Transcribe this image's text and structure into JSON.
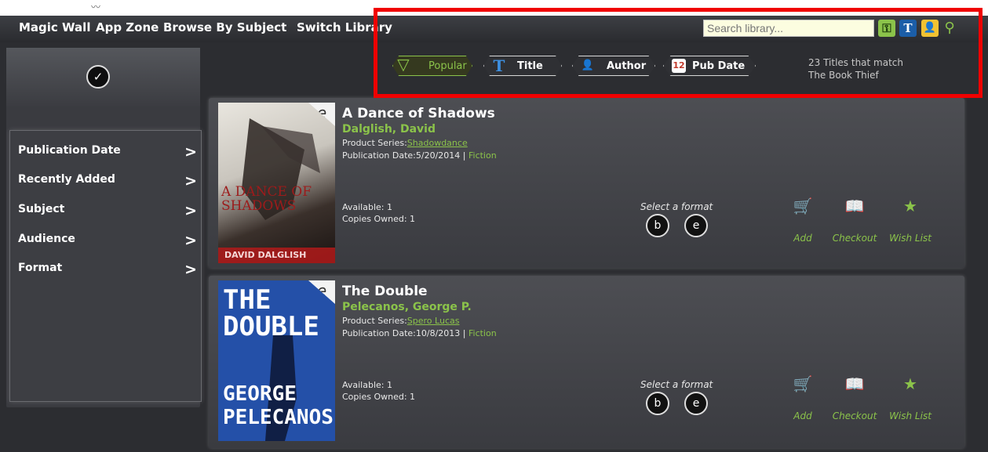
{
  "nav": {
    "items": [
      "Magic Wall",
      "App Zone",
      "Browse By Subject",
      "Switch Library"
    ]
  },
  "search": {
    "placeholder": "Search library..."
  },
  "toolbar_icons": [
    "key-icon",
    "title-icon",
    "author-icon",
    "search-icon"
  ],
  "sort": {
    "options": [
      "Popular",
      "Title",
      "Author",
      "Pub Date"
    ],
    "active": "Popular",
    "match_line1": "23 Titles that match",
    "match_line2": "The Book Thief"
  },
  "sidebar": {
    "filters": [
      "Publication Date",
      "Recently Added",
      "Subject",
      "Audience",
      "Format"
    ],
    "chevron": ">"
  },
  "books": [
    {
      "title": "A Dance of Shadows",
      "author": "Dalglish, David",
      "series_label": "Product Series:",
      "series": "Shadowdance",
      "pub_label": "Publication Date:",
      "pub_date": "5/20/2014",
      "genre": "Fiction",
      "available": "Available: 1",
      "copies": "Copies Owned: 1",
      "cover": {
        "top_text": "A DANCE OF SHADOWS",
        "author_text": "DAVID DALGLISH",
        "colors": [
          "#d9d6cf",
          "#2a2320",
          "#b21a1a"
        ]
      }
    },
    {
      "title": "The Double",
      "author": "Pelecanos, George P.",
      "series_label": "Product Series:",
      "series": "Spero Lucas",
      "pub_label": "Publication Date:",
      "pub_date": "10/8/2013",
      "genre": "Fiction",
      "available": "Available: 1",
      "copies": "Copies Owned: 1",
      "cover": {
        "top_text": "THE DOUBLE",
        "author_text": "GEORGE PELECANOS",
        "colors": [
          "#2450a8",
          "#ffffff",
          "#0e1a3a"
        ]
      }
    }
  ],
  "format": {
    "label": "Select a format"
  },
  "actions": [
    "Add",
    "Checkout",
    "Wish List"
  ],
  "colors": {
    "accent": "#8bc34a",
    "highlight_frame": "#f00000",
    "nav_bg": "#2f3034"
  }
}
